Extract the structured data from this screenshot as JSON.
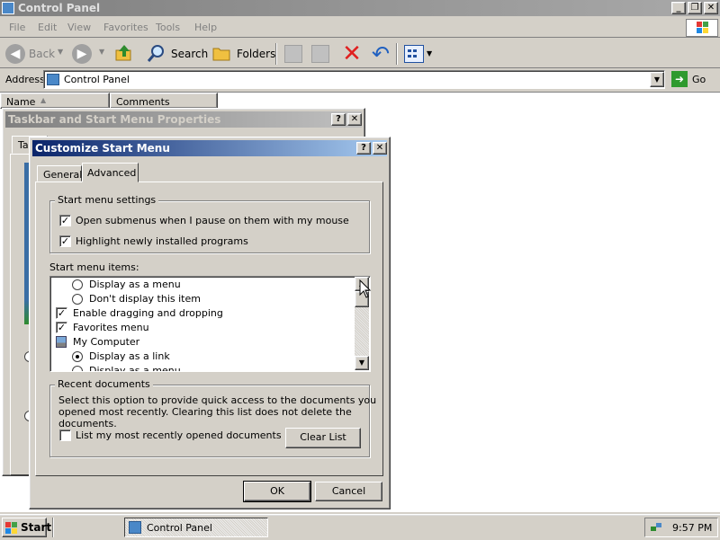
{
  "window": {
    "title": "Control Panel"
  },
  "menubar": [
    "File",
    "Edit",
    "View",
    "Favorites",
    "Tools",
    "Help"
  ],
  "toolbar": {
    "back": "Back",
    "search": "Search",
    "folders": "Folders"
  },
  "address": {
    "label": "Address",
    "value": "Control Panel",
    "go": "Go"
  },
  "columns": [
    "Name",
    "Comments"
  ],
  "taskbar_props": {
    "title": "Taskbar and Start Menu Properties",
    "tab_partial": "Ta"
  },
  "dialog": {
    "title": "Customize Start Menu",
    "tabs": [
      "General",
      "Advanced"
    ],
    "settings_group": "Start menu settings",
    "opt_submenus": "Open submenus when I pause on them with my mouse",
    "opt_highlight": "Highlight newly installed programs",
    "items_label": "Start menu items:",
    "items": [
      {
        "type": "radio",
        "checked": false,
        "indent": true,
        "text": "Display as a menu"
      },
      {
        "type": "radio",
        "checked": false,
        "indent": true,
        "text": "Don't display this item"
      },
      {
        "type": "check",
        "checked": true,
        "indent": false,
        "text": "Enable dragging and dropping"
      },
      {
        "type": "check",
        "checked": true,
        "indent": false,
        "text": "Favorites menu"
      },
      {
        "type": "icon",
        "checked": false,
        "indent": false,
        "text": "My Computer"
      },
      {
        "type": "radio",
        "checked": true,
        "indent": true,
        "text": "Display as a link"
      },
      {
        "type": "radio",
        "checked": false,
        "indent": true,
        "text": "Display as a menu"
      }
    ],
    "recent_group": "Recent documents",
    "recent_desc_1": "Select this option to provide quick access to the documents you",
    "recent_desc_2": "opened most recently.  Clearing this list does not delete the documents.",
    "recent_check": "List my most recently opened documents",
    "clear_list": "Clear List",
    "ok": "OK",
    "cancel": "Cancel"
  },
  "taskbar": {
    "start": "Start",
    "task": "Control Panel",
    "clock": "9:57 PM"
  },
  "colors": {
    "title_active": "#0a246a",
    "title_inactive": "#808080",
    "face": "#d4d0c8"
  }
}
